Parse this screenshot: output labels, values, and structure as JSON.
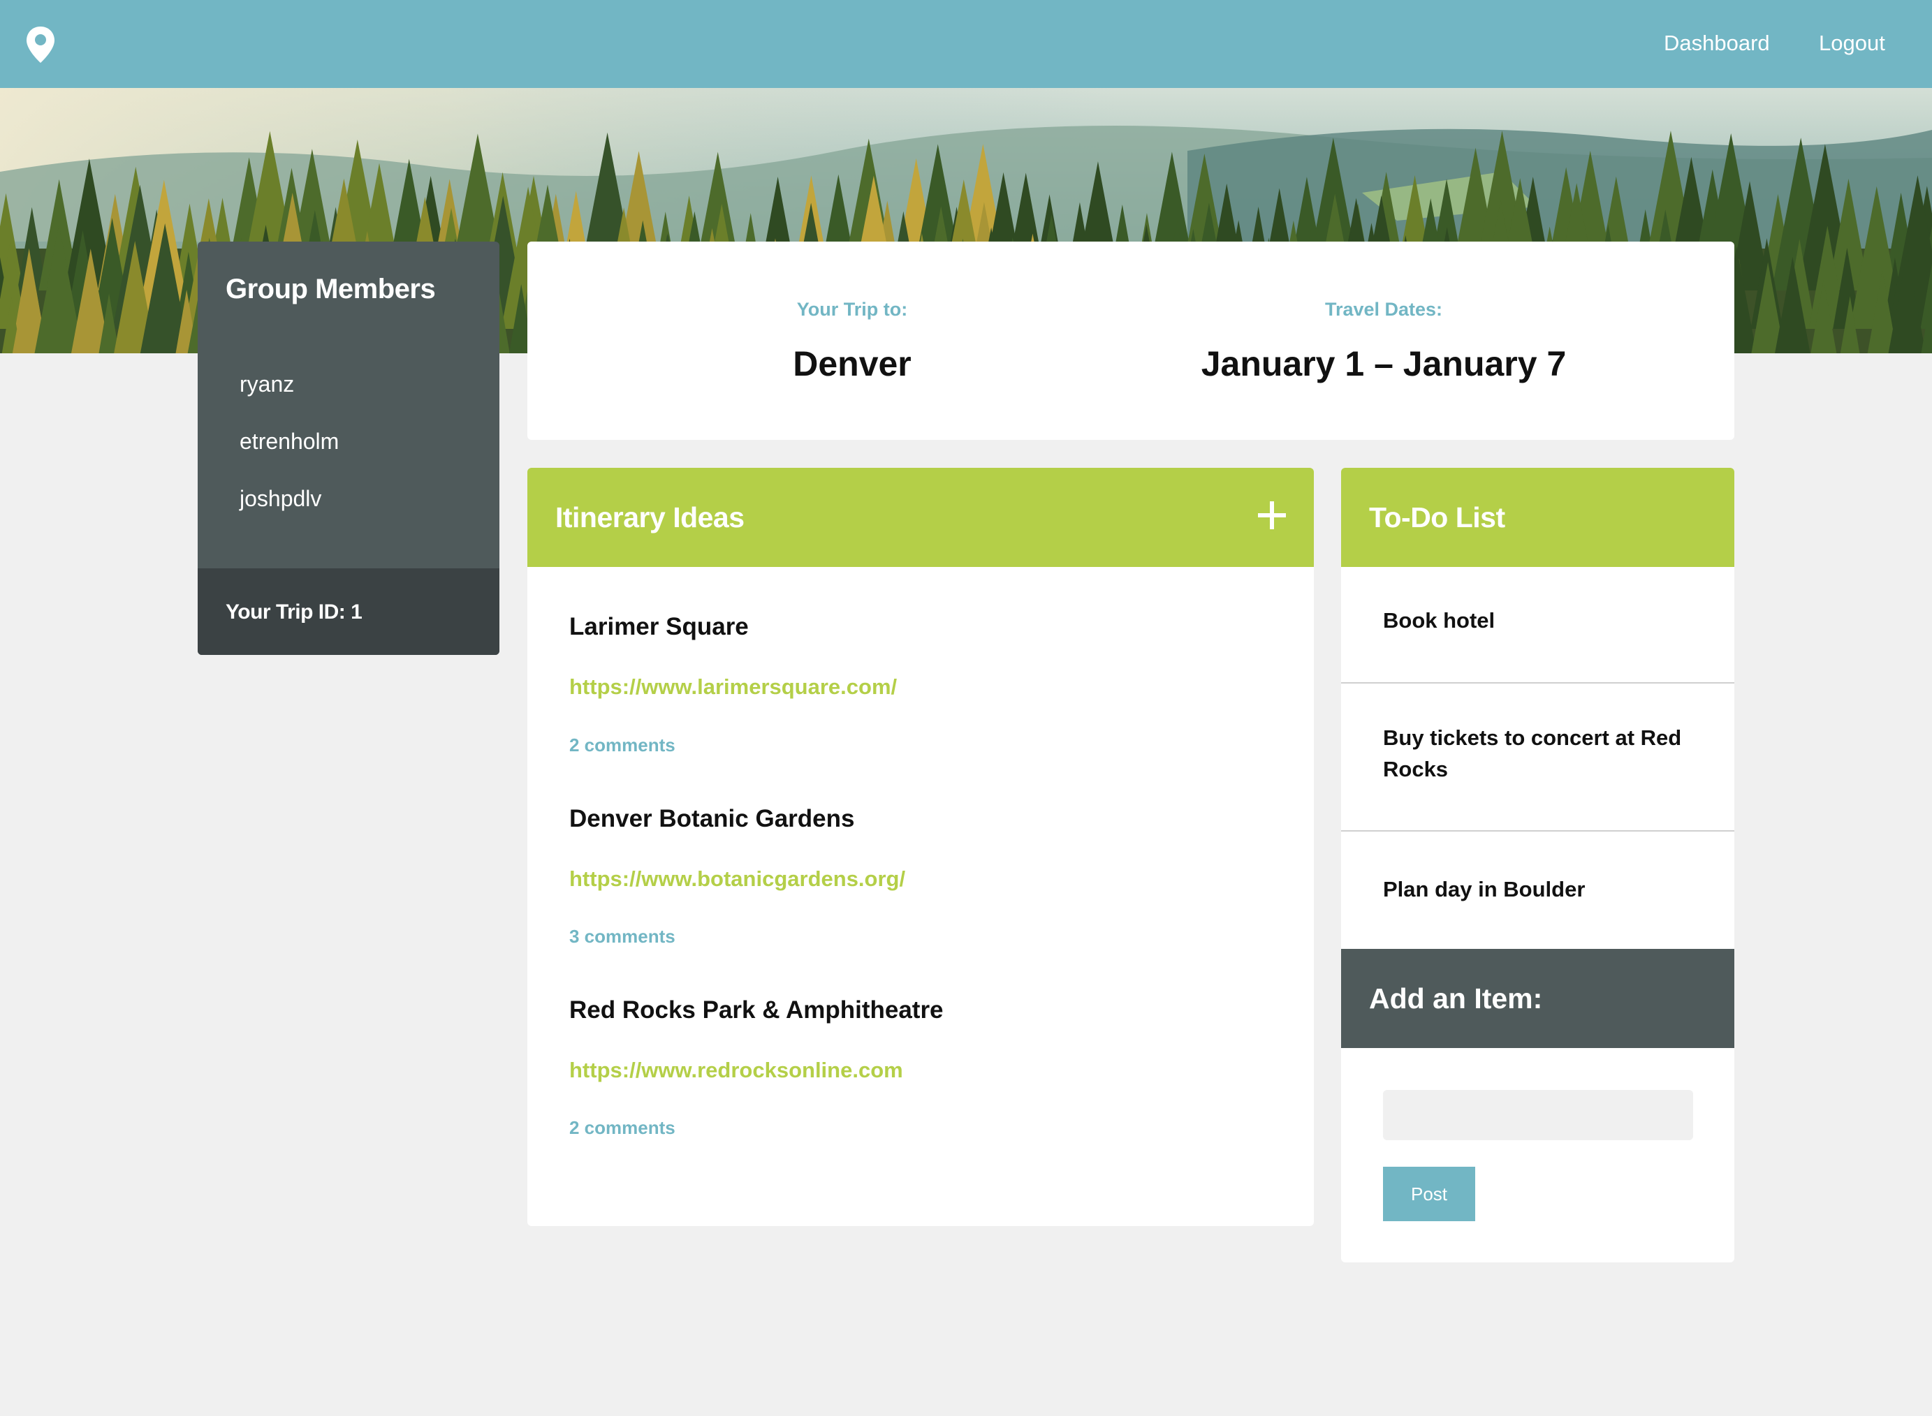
{
  "nav": {
    "logo_icon": "map-pin-icon",
    "dashboard_label": "Dashboard",
    "logout_label": "Logout",
    "bar_color": "#72b6c4"
  },
  "members": {
    "title": "Group Members",
    "items": [
      "ryanz",
      "etrenholm",
      "joshpdlv"
    ],
    "trip_id_label": "Your Trip ID: 1"
  },
  "trip": {
    "destination_label": "Your Trip to:",
    "destination": "Denver",
    "dates_label": "Travel Dates:",
    "dates": "January 1 – January 7"
  },
  "itinerary": {
    "title": "Itinerary Ideas",
    "add_icon": "plus-icon",
    "ideas": [
      {
        "title": "Larimer Square",
        "url": "https://www.larimersquare.com/",
        "comments": "2 comments"
      },
      {
        "title": "Denver Botanic Gardens",
        "url": "https://www.botanicgardens.org/",
        "comments": "3 comments"
      },
      {
        "title": "Red Rocks Park & Amphitheatre",
        "url": "https://www.redrocksonline.com",
        "comments": "2 comments"
      }
    ]
  },
  "todo": {
    "title": "To-Do List",
    "items": [
      "Book hotel",
      "Buy tickets to concert at Red Rocks",
      "Plan day in Boulder"
    ],
    "add_title": "Add an Item:",
    "input_placeholder": "",
    "post_label": "Post"
  },
  "colors": {
    "accent_green": "#b4cf48",
    "accent_blue": "#72b6c4",
    "dark_slate": "#4f5a5b"
  }
}
